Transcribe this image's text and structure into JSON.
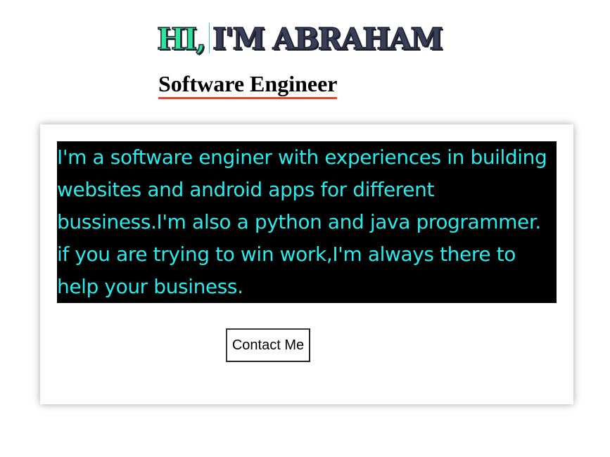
{
  "hero": {
    "greeting": "HI,",
    "name": "I'M ABRAHAM",
    "subtitle": "Software Engineer"
  },
  "about": {
    "text": "I'm a software enginer with experiences in building websites and android apps for different bussiness.I'm also a python and java programmer. if you are trying to win work,I'm always there to help your business."
  },
  "actions": {
    "contact_label": "Contact Me"
  },
  "colors": {
    "greeting": "#2ee39a",
    "name": "#3a3f58",
    "underline": "#e2452a",
    "bio_background": "#000000",
    "bio_text": "#28ecec"
  }
}
